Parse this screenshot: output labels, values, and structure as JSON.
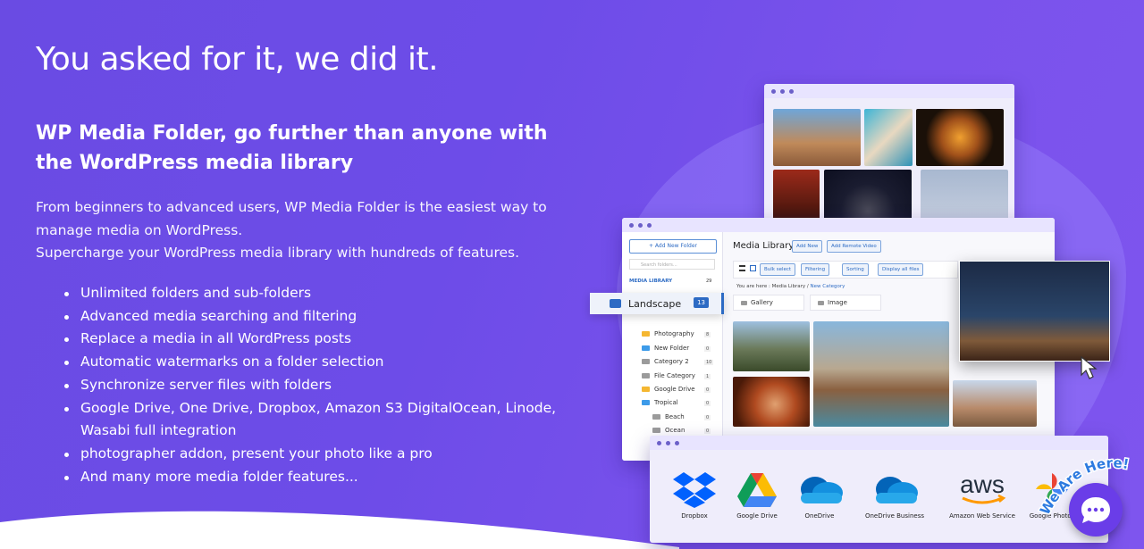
{
  "headline": "You asked for it, we did it.",
  "subheadline": "WP Media Folder, go further than anyone with the WordPress media library",
  "description": [
    "From beginners to advanced users, WP Media Folder is the easiest way to manage media on WordPress.",
    "Supercharge your WordPress media library with hundreds of features."
  ],
  "features": [
    "Unlimited folders and sub-folders",
    "Advanced media searching and filtering",
    "Replace a media in all WordPress posts",
    "Automatic watermarks on a folder selection",
    "Synchronize server files with folders",
    "Google Drive, One Drive, Dropbox, Amazon S3 DigitalOcean, Linode, Wasabi full integration",
    "photographer addon, present your photo like a pro",
    "And many more media folder features..."
  ],
  "mockup": {
    "add_new_folder": "+ Add New Folder",
    "search_placeholder": "Search folders...",
    "media_library_label": "MEDIA LIBRARY",
    "media_library_count": "29",
    "landscape": {
      "label": "Landscape",
      "count": "13"
    },
    "folders": [
      {
        "label": "Photography",
        "count": "8",
        "color": "#f5b731"
      },
      {
        "label": "New Folder",
        "count": "0",
        "color": "#3d9be9"
      },
      {
        "label": "Category 2",
        "count": "10",
        "color": "#9b9b9b"
      },
      {
        "label": "File Category",
        "count": "1",
        "color": "#9b9b9b"
      },
      {
        "label": "Google Drive",
        "count": "0",
        "color": "#f5b731"
      },
      {
        "label": "Tropical",
        "count": "0",
        "color": "#3d9be9"
      },
      {
        "label": "Beach",
        "count": "0",
        "color": "#9b9b9b"
      },
      {
        "label": "Ocean",
        "count": "0",
        "color": "#9b9b9b"
      }
    ],
    "media_library_title": "Media Library",
    "add_new": "Add New",
    "add_remote_video": "Add Remote Video",
    "bulk_select": "Bulk select",
    "filtering": "Filtering",
    "sorting": "Sorting",
    "display_all_files": "Display all files",
    "breadcrumb_prefix": "You are here :",
    "breadcrumb_root": "Media Library",
    "breadcrumb_current": "New Category",
    "folder_gallery": "Gallery",
    "folder_image": "Image"
  },
  "services": [
    {
      "name": "Dropbox",
      "icon": "dropbox-icon"
    },
    {
      "name": "Google Drive",
      "icon": "google-drive-icon"
    },
    {
      "name": "OneDrive",
      "icon": "onedrive-icon"
    },
    {
      "name": "OneDrive Business",
      "icon": "onedrive-business-icon"
    },
    {
      "name": "Amazon Web Service",
      "icon": "aws-icon"
    },
    {
      "name": "Google Photos",
      "icon": "google-photos-icon"
    }
  ],
  "chat": {
    "badge_text": "We Are Here!"
  },
  "colors": {
    "accent": "#2d6bc4",
    "background": "#6d4ce8",
    "chat": "#6a3de8"
  }
}
